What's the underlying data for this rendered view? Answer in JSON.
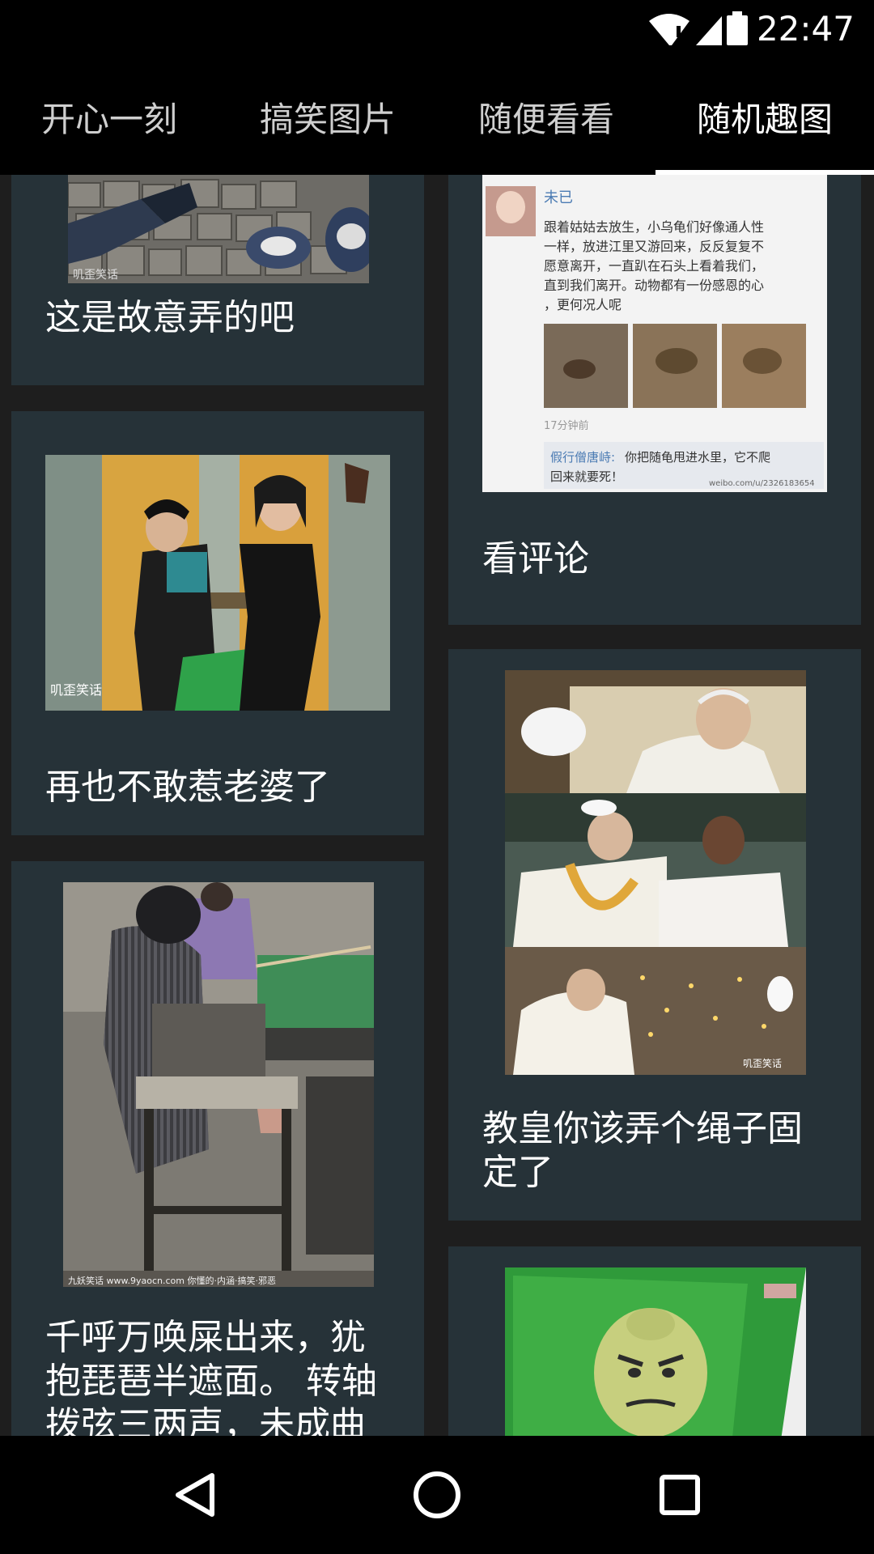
{
  "status_bar": {
    "time": "22:47",
    "icons": [
      "wifi-alert-icon",
      "cell-signal-icon",
      "battery-icon"
    ]
  },
  "tabs": [
    {
      "label": "开心一刻",
      "active": false
    },
    {
      "label": "搞笑图片",
      "active": false
    },
    {
      "label": "随便看看",
      "active": false
    },
    {
      "label": "随机趣图",
      "active": true
    }
  ],
  "left_column": [
    {
      "caption": "这是故意弄的吧"
    },
    {
      "caption": "再也不敢惹老婆了"
    },
    {
      "caption": "千呼万唤屎出来，犹抱琵琶半遮面。 转轴拨弦三两声，未成曲"
    }
  ],
  "right_column": [
    {
      "caption": "看评论"
    },
    {
      "caption": "教皇你该弄个绳子固定了"
    },
    {
      "caption": ""
    }
  ],
  "colors": {
    "card_bg": "#263238",
    "page_bg": "#1e1e1e",
    "bars_bg": "#000000",
    "tab_indicator": "#ffffff"
  },
  "nav": {
    "icons": [
      "back-icon",
      "home-icon",
      "recents-icon"
    ]
  }
}
